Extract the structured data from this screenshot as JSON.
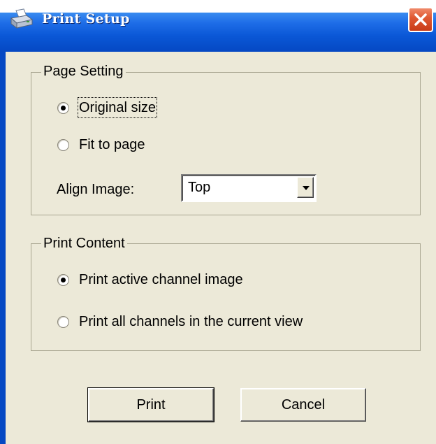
{
  "window": {
    "title": "Print Setup"
  },
  "page_setting": {
    "legend": "Page Setting",
    "options": [
      {
        "label": "Original size",
        "checked": true
      },
      {
        "label": "Fit to page",
        "checked": false
      }
    ],
    "align_label": "Align Image:",
    "align_value": "Top"
  },
  "print_content": {
    "legend": "Print Content",
    "options": [
      {
        "label": "Print active channel image",
        "checked": true
      },
      {
        "label": "Print all channels in the current view",
        "checked": false
      }
    ]
  },
  "buttons": {
    "print": "Print",
    "cancel": "Cancel"
  },
  "icons": {
    "app": "printer-icon",
    "close": "close-icon",
    "dropdown": "chevron-down-icon"
  },
  "colors": {
    "titlebar": "#0a57d6",
    "client": "#ece9d8",
    "close": "#e05a34"
  }
}
